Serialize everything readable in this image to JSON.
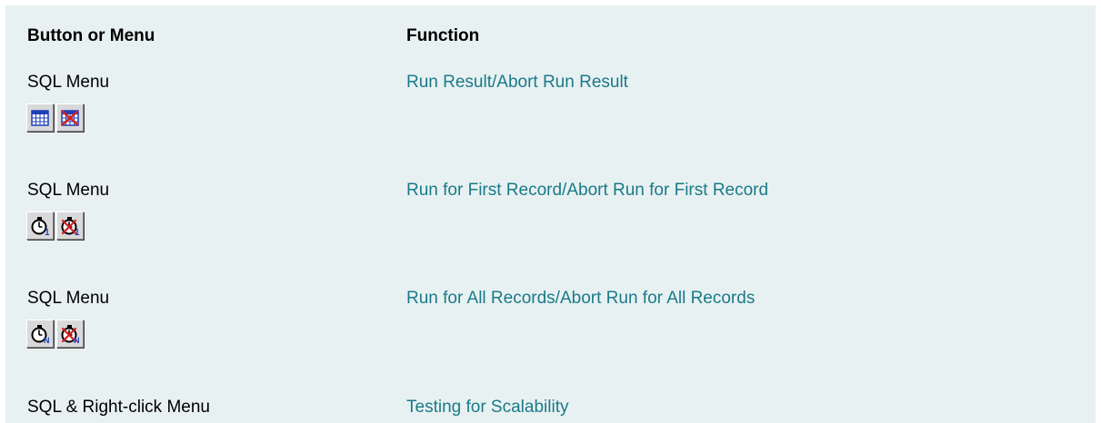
{
  "table": {
    "headers": {
      "button_or_menu": "Button or Menu",
      "function": "Function"
    },
    "rows": [
      {
        "menu": "SQL Menu",
        "function": "Run Result/Abort Run Result",
        "icons": [
          "run-result-icon",
          "abort-run-result-icon"
        ]
      },
      {
        "menu": "SQL Menu",
        "function": "Run for First Record/Abort Run for First Record",
        "icons": [
          "run-first-record-stopwatch-icon",
          "abort-run-first-record-stopwatch-icon"
        ],
        "icon_letter": "1"
      },
      {
        "menu": "SQL Menu",
        "function": "Run for All Records/Abort Run for All Records",
        "icons": [
          "run-all-records-stopwatch-icon",
          "abort-run-all-records-stopwatch-icon"
        ],
        "icon_letter": "N"
      },
      {
        "menu": "SQL & Right-click Menu",
        "function": "Testing for Scalability"
      }
    ]
  },
  "colors": {
    "background": "#e8f1f1",
    "link": "#1a7a8a",
    "icon_blue": "#1f3fb8",
    "icon_red": "#d42020"
  }
}
